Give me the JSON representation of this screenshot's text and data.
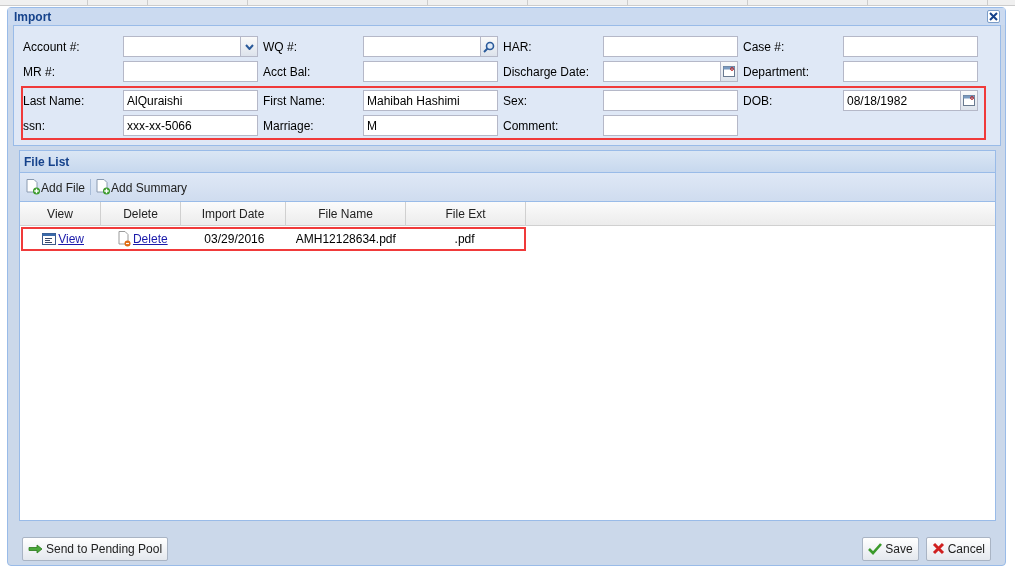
{
  "window": {
    "title": "Import",
    "form": {
      "groups": [
        {
          "highlighted": false,
          "rows": [
            [
              {
                "label": "Account #:",
                "kind": "combo"
              },
              {
                "label": "WQ #:",
                "kind": "search"
              },
              {
                "label": "HAR:",
                "kind": "text"
              },
              {
                "label": "Case #:",
                "kind": "text"
              }
            ],
            [
              {
                "label": "MR #:",
                "kind": "text"
              },
              {
                "label": "Acct Bal:",
                "kind": "text"
              },
              {
                "label": "Discharge Date:",
                "kind": "date"
              },
              {
                "label": "Department:",
                "kind": "text"
              }
            ]
          ]
        },
        {
          "highlighted": true,
          "rows": [
            [
              {
                "label": "Last Name:",
                "kind": "text",
                "value": "AlQuraishi"
              },
              {
                "label": "First Name:",
                "kind": "text",
                "value": "Mahibah Hashimi"
              },
              {
                "label": "Sex:",
                "kind": "text"
              },
              {
                "label": "DOB:",
                "kind": "date",
                "value": "08/18/1982"
              }
            ],
            [
              {
                "label": "ssn:",
                "kind": "text",
                "value": "xxx-xx-5066"
              },
              {
                "label": "Marriage:",
                "kind": "text",
                "value": "M"
              },
              {
                "label": "Comment:",
                "kind": "text"
              }
            ]
          ]
        }
      ]
    },
    "file_list": {
      "title": "File List",
      "toolbar": [
        {
          "label": "Add File"
        },
        {
          "label": "Add Summary"
        }
      ],
      "columns": [
        "View",
        "Delete",
        "Import Date",
        "File Name",
        "File Ext"
      ],
      "rows": [
        {
          "highlighted": true,
          "view": "View",
          "delete": "Delete",
          "import_date": "03/29/2016",
          "file_name": "AMH12128634.pdf",
          "file_ext": ".pdf"
        }
      ]
    },
    "footer": {
      "left_button": "Send to Pending Pool",
      "buttons": [
        {
          "label": "Save",
          "kind": "save"
        },
        {
          "label": "Cancel",
          "kind": "cancel"
        }
      ]
    }
  }
}
